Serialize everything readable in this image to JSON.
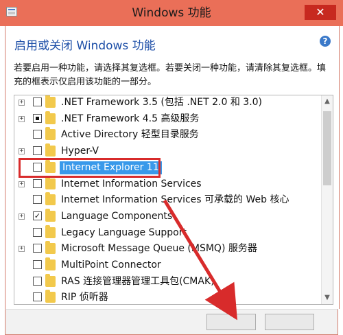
{
  "window": {
    "title": "Windows 功能"
  },
  "heading": {
    "text": "启用或关闭 Windows 功能"
  },
  "description": {
    "text": "若要启用一种功能，请选择其复选框。若要关闭一种功能，请清除其复选框。填充的框表示仅启用该功能的一部分。"
  },
  "features": [
    {
      "label": ".NET Framework 3.5 (包括 .NET 2.0 和 3.0)",
      "expand": true,
      "state": "unchecked"
    },
    {
      "label": ".NET Framework 4.5 高级服务",
      "expand": true,
      "state": "partial"
    },
    {
      "label": "Active Directory 轻型目录服务",
      "expand": false,
      "state": "unchecked"
    },
    {
      "label": "Hyper-V",
      "expand": true,
      "state": "unchecked"
    },
    {
      "label": "Internet Explorer 11",
      "expand": false,
      "state": "unchecked",
      "selected": true
    },
    {
      "label": "Internet Information Services",
      "expand": true,
      "state": "unchecked"
    },
    {
      "label": "Internet Information Services 可承载的 Web 核心",
      "expand": false,
      "state": "unchecked"
    },
    {
      "label": "Language Components",
      "expand": true,
      "state": "checked"
    },
    {
      "label": "Legacy Language Support",
      "expand": false,
      "state": "unchecked"
    },
    {
      "label": "Microsoft Message Queue (MSMQ) 服务器",
      "expand": true,
      "state": "unchecked"
    },
    {
      "label": "MultiPoint Connector",
      "expand": false,
      "state": "unchecked"
    },
    {
      "label": "RAS 连接管理器管理工具包(CMAK)",
      "expand": false,
      "state": "unchecked"
    },
    {
      "label": "RIP 侦听器",
      "expand": false,
      "state": "unchecked"
    }
  ],
  "colors": {
    "titlebar": "#ea6f58",
    "close": "#c7291f",
    "heading": "#1c4ea7",
    "selection": "#3999ea",
    "highlight": "#d82b2b"
  },
  "icons": {
    "help": "help-icon",
    "close": "close-icon",
    "folder": "folder-icon",
    "expand": "plus-icon",
    "scroll_up": "chevron-up-icon",
    "scroll_down": "chevron-down-icon"
  }
}
